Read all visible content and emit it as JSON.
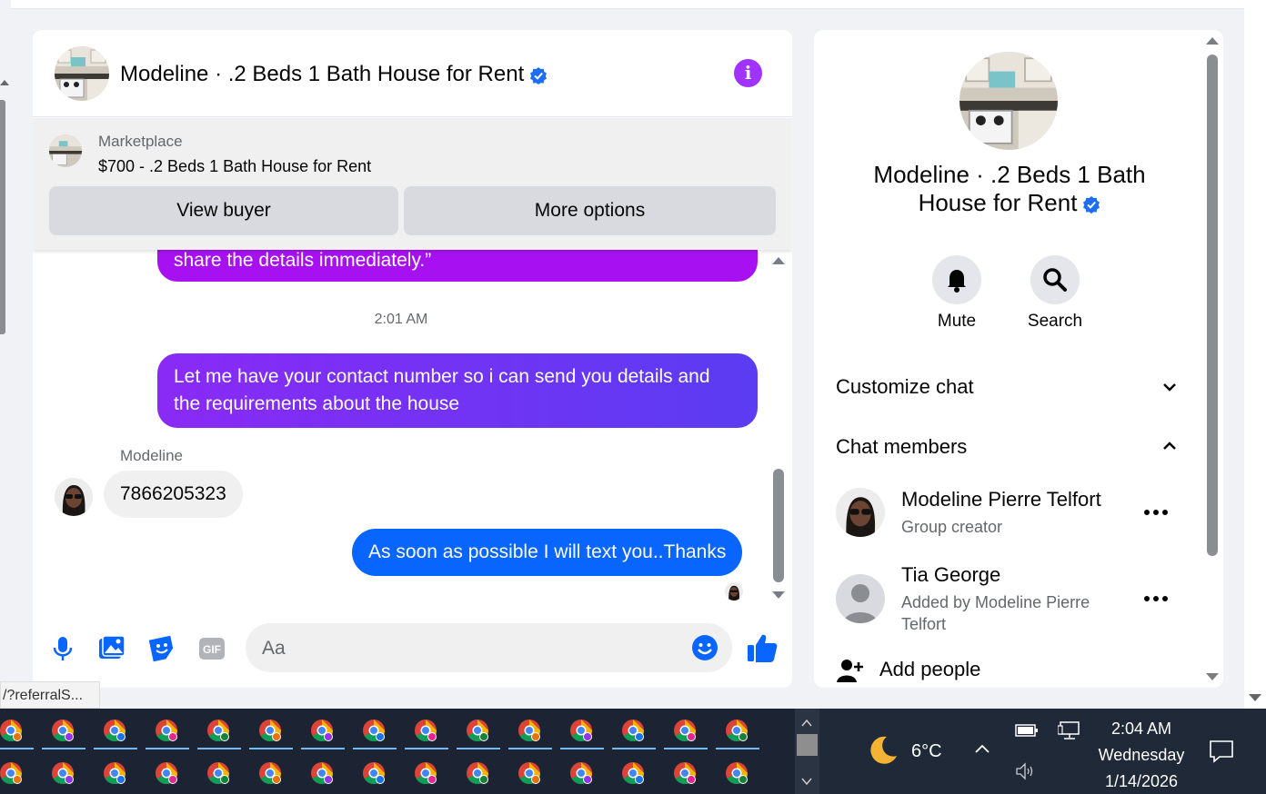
{
  "chat": {
    "title": "Modeline · .2 Beds 1 Bath House for Rent",
    "marketplace_label": "Marketplace",
    "listing": "$700 - .2 Beds 1 Bath House for Rent",
    "view_buyer": "View buyer",
    "more_options": "More options",
    "messages": {
      "partial_top": "share the details immediately.”",
      "timestamp": "2:01 AM",
      "outgoing_1": "Let me have your contact number so i can send you details and the requirements about the house",
      "sender_name": "Modeline",
      "incoming_1": "7866205323",
      "outgoing_2": "As soon as possible I will text you..Thanks"
    },
    "composer_placeholder": "Aa"
  },
  "side": {
    "title": "Modeline · .2 Beds 1 Bath House for Rent",
    "mute": "Mute",
    "search": "Search",
    "customize": "Customize chat",
    "members_title": "Chat members",
    "members": [
      {
        "name": "Modeline Pierre Telfort",
        "sub": "Group creator"
      },
      {
        "name": "Tia George",
        "sub": "Added by Modeline Pierre Telfort"
      }
    ],
    "add_people": "Add people"
  },
  "status_url": "/?referralS...",
  "tray": {
    "temp": "6°C",
    "time": "2:04 AM",
    "day": "Wednesday",
    "date": "1/14/2026"
  },
  "colors": {
    "accent_purple": "#a033ff",
    "messenger_blue": "#0866ff",
    "taskbar": "#1f2937"
  }
}
